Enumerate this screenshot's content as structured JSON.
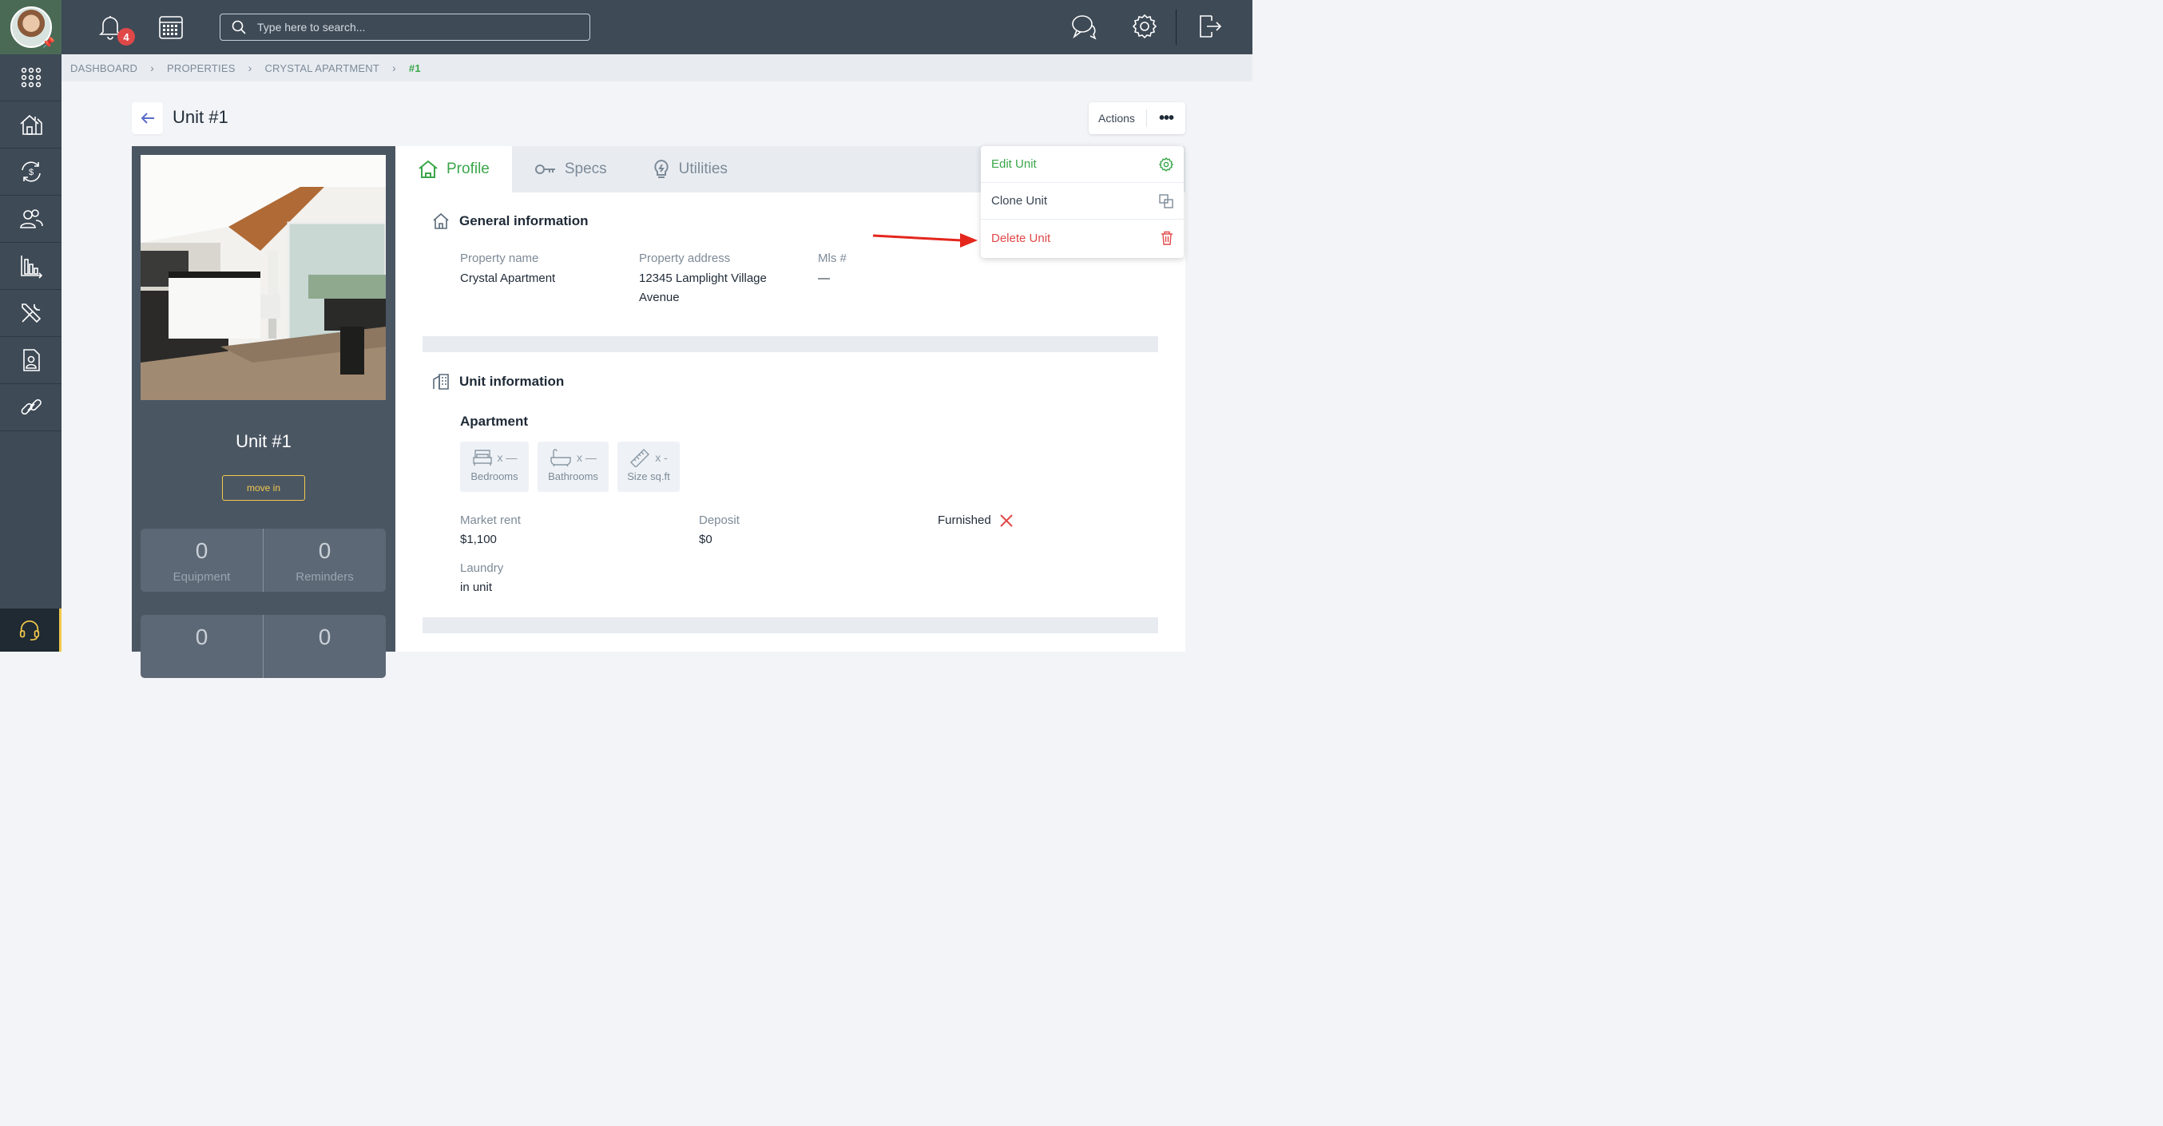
{
  "topbar": {
    "notifications_count": "4",
    "search_placeholder": "Type here to search..."
  },
  "breadcrumb": [
    "DASHBOARD",
    "PROPERTIES",
    "CRYSTAL APARTMENT",
    "#1"
  ],
  "header": {
    "title": "Unit #1",
    "actions_label": "Actions"
  },
  "dropdown": {
    "edit": "Edit Unit",
    "clone": "Clone Unit",
    "delete": "Delete Unit"
  },
  "left_panel": {
    "unit_name": "Unit #1",
    "move_in": "move in",
    "stats": [
      {
        "value": "0",
        "label": "Equipment"
      },
      {
        "value": "0",
        "label": "Reminders"
      },
      {
        "value": "0",
        "label": ""
      },
      {
        "value": "0",
        "label": ""
      }
    ]
  },
  "tabs": {
    "profile": "Profile",
    "specs": "Specs",
    "utilities": "Utilities"
  },
  "general": {
    "heading": "General information",
    "property_name_label": "Property name",
    "property_name": "Crystal Apartment",
    "property_address_label": "Property address",
    "property_address_line1": "12345 Lamplight Village",
    "property_address_line2": "Avenue",
    "mls_label": "Mls #",
    "mls": "—"
  },
  "unit_info": {
    "heading": "Unit information",
    "type": "Apartment",
    "bedrooms_value": "x —",
    "bedrooms_label": "Bedrooms",
    "bathrooms_value": "x —",
    "bathrooms_label": "Bathrooms",
    "size_value": "x -",
    "size_label": "Size sq.ft",
    "market_rent_label": "Market rent",
    "market_rent": "$1,100",
    "deposit_label": "Deposit",
    "deposit": "$0",
    "furnished_label": "Furnished",
    "laundry_label": "Laundry",
    "laundry": "in unit"
  },
  "colors": {
    "accent_green": "#3aa64a",
    "danger_red": "#e04848",
    "sidebar_bg": "#3e4a56",
    "highlight_yellow": "#f2c94c"
  }
}
